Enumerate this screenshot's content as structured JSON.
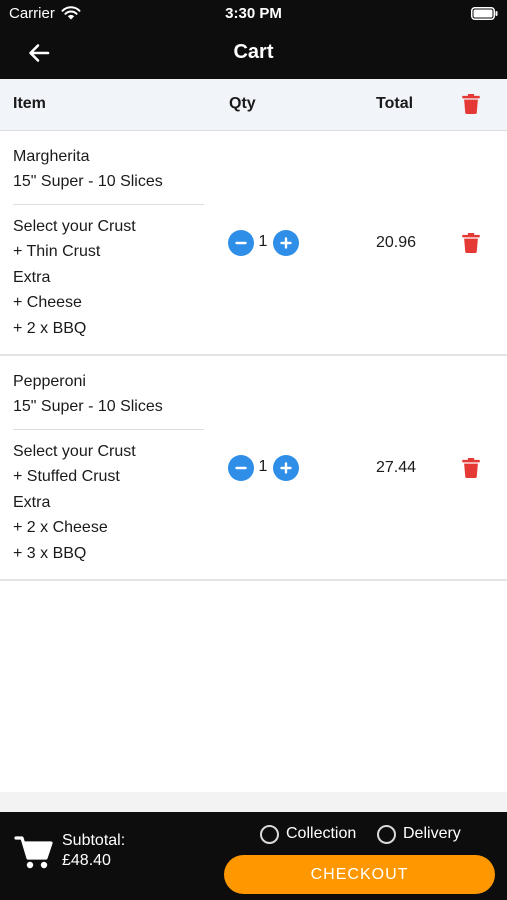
{
  "status_bar": {
    "carrier": "Carrier",
    "time": "3:30 PM",
    "wifi_icon": "wifi-icon",
    "battery_icon": "battery-icon"
  },
  "nav": {
    "title": "Cart",
    "back_icon": "arrow-left-icon"
  },
  "table_header": {
    "item": "Item",
    "qty": "Qty",
    "total": "Total",
    "delete_icon": "trash-icon"
  },
  "cart": {
    "items": [
      {
        "name": "Margherita",
        "size": "15\" Super - 10 Slices",
        "options": [
          "Select your Crust",
          "+ Thin Crust",
          "Extra",
          "+ Cheese",
          "+ 2 x BBQ"
        ],
        "qty": "1",
        "total": "20.96"
      },
      {
        "name": "Pepperoni",
        "size": "15\" Super - 10 Slices",
        "options": [
          "Select your Crust",
          "+ Stuffed Crust",
          "Extra",
          "+ 2 x Cheese",
          "+ 3 x BBQ"
        ],
        "qty": "1",
        "total": "27.44"
      }
    ]
  },
  "footer": {
    "cart_icon": "shopping-cart-icon",
    "subtotal_label": "Subtotal:",
    "subtotal_value": "£48.40",
    "collection_label": "Collection",
    "delivery_label": "Delivery",
    "checkout_label": "CHECKOUT"
  },
  "colors": {
    "accent": "#ff9800",
    "qty_button": "#2e8ee8",
    "delete": "#e53935",
    "bar": "#0d0d0d"
  }
}
